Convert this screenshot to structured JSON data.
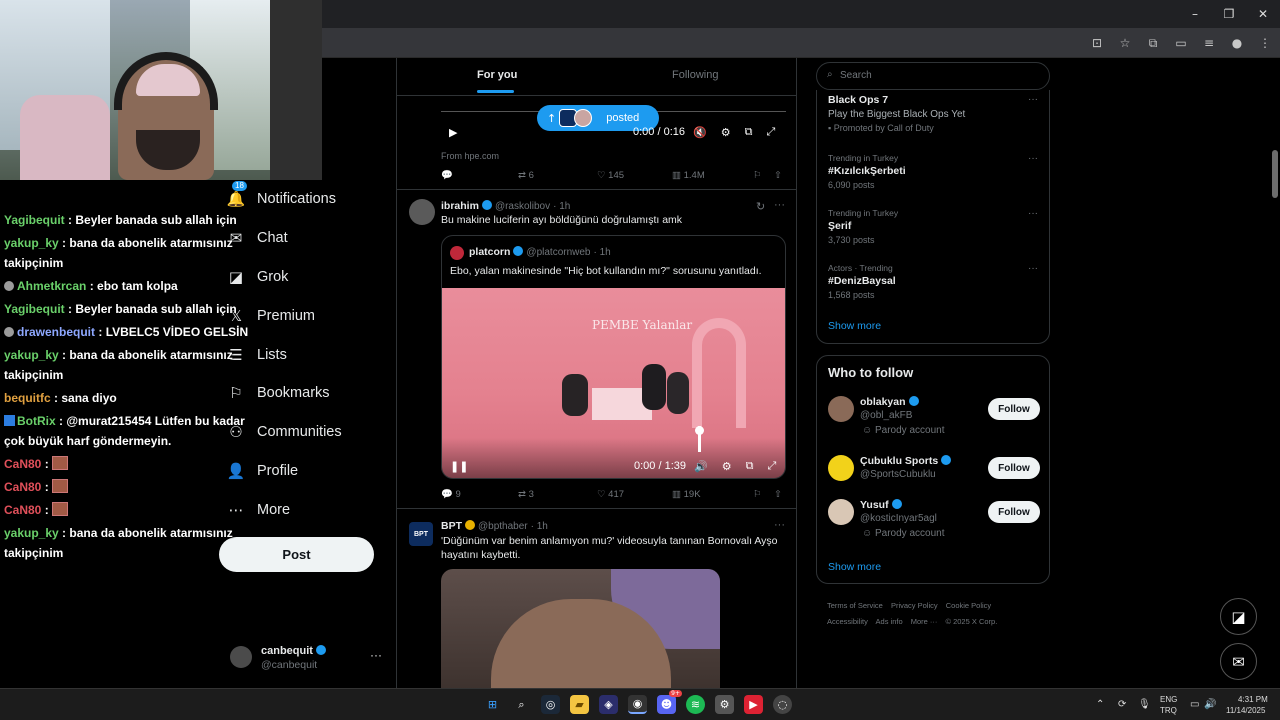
{
  "window": {
    "controls": [
      "–",
      "❐",
      "✕"
    ],
    "toolbar_icons": [
      "install-icon",
      "star-icon",
      "extensions-icon",
      "split-icon",
      "queue-icon",
      "profile-icon",
      "menu-icon"
    ]
  },
  "stream_chat": [
    {
      "user": "Yagibequit",
      "user_color": "#6ad06a",
      "text": "Beyler banada sub allah için"
    },
    {
      "user": "yakup_ky",
      "user_color": "#6ad06a",
      "text": "bana da abonelik atarmısınız takipçinim"
    },
    {
      "user": "Ahmetkrcan",
      "user_color": "#6ad06a",
      "badge": true,
      "text": "ebo tam kolpa"
    },
    {
      "user": "Yagibequit",
      "user_color": "#6ad06a",
      "text": "Beyler banada sub allah için"
    },
    {
      "user": "drawenbequit",
      "user_color": "#8ea8ff",
      "badge": true,
      "text": "LVBELC5 VİDEO GELSİN"
    },
    {
      "user": "yakup_ky",
      "user_color": "#6ad06a",
      "text": "bana da abonelik atarmısınız takipçinim"
    },
    {
      "user": "bequitfc",
      "user_color": "#e0a040",
      "text": "sana diyo"
    },
    {
      "user": "BotRix",
      "user_color": "#6ad06a",
      "bot": true,
      "text": "@murat215454 Lütfen bu kadar çok büyük harf göndermeyin."
    },
    {
      "user": "CaN80",
      "user_color": "#e0505a",
      "emote": true,
      "text": ""
    },
    {
      "user": "CaN80",
      "user_color": "#e0505a",
      "emote": true,
      "text": ""
    },
    {
      "user": "CaN80",
      "user_color": "#e0505a",
      "emote": true,
      "text": ""
    },
    {
      "user": "yakup_ky",
      "user_color": "#6ad06a",
      "text": "bana da abonelik atarmısınız takipçinim"
    }
  ],
  "nav": {
    "notifications_count": "18",
    "items": [
      {
        "label": "Notifications",
        "icon": "🔔"
      },
      {
        "label": "Chat",
        "icon": "✉"
      },
      {
        "label": "Grok",
        "icon": "◪"
      },
      {
        "label": "Premium",
        "icon": "𝕏"
      },
      {
        "label": "Lists",
        "icon": "☰"
      },
      {
        "label": "Bookmarks",
        "icon": "⚐"
      },
      {
        "label": "Communities",
        "icon": "⚇"
      },
      {
        "label": "Profile",
        "icon": "👤"
      },
      {
        "label": "More",
        "icon": "⋯"
      }
    ],
    "post_label": "Post",
    "account_name": "canbequit",
    "account_handle": "@canbequit",
    "account_more": "···"
  },
  "feed": {
    "tab_foryou": "For you",
    "tab_following": "Following",
    "posted_pill": "posted",
    "video1": {
      "time": "0:00 / 0:16",
      "source": "From hpe.com"
    },
    "post0_actions": {
      "reposts": "6",
      "likes": "145",
      "views": "1.4M"
    },
    "tweet1": {
      "name": "ibrahim",
      "handle": "@raskolibov",
      "time": "· 1h",
      "text": "Bu makine luciferin ayı böldüğünü doğrulamıştı amk",
      "quote": {
        "name": "platcorn",
        "handle": "@platcornweb",
        "time": "· 1h",
        "text": "Ebo, yalan makinesinde \"Hiç bot kullandın mı?\" sorusunu yanıtladı.",
        "sign": "PEMBE Yalanlar",
        "video_time": "0:00 / 1:39"
      },
      "actions": {
        "replies": "9",
        "reposts": "3",
        "likes": "417",
        "views": "19K"
      }
    },
    "tweet2": {
      "name": "BPT",
      "avatar_text": "BPT",
      "handle": "@bpthaber",
      "time": "· 1h",
      "text_line1": "'Düğünüm var benim anlamıyon mu?' videosuyla tanınan Bornovalı Ayşo",
      "text_line2": "hayatını kaybetti."
    }
  },
  "right": {
    "search_placeholder": "Search",
    "trends": [
      {
        "top": "",
        "title": "Black Ops 7",
        "sub": "Play the Biggest Black Ops Yet",
        "meta": "Promoted by Call of Duty"
      },
      {
        "top": "Trending in Turkey",
        "title": "#KızılcıkŞerbeti",
        "sub": "",
        "meta": "6,090 posts"
      },
      {
        "top": "Trending in Turkey",
        "title": "Şerif",
        "sub": "",
        "meta": "3,730 posts"
      },
      {
        "top": "Actors · Trending",
        "title": "#DenizBaysal",
        "sub": "",
        "meta": "1,568 posts"
      }
    ],
    "show_more": "Show more",
    "who_to_follow_title": "Who to follow",
    "follow_label": "Follow",
    "follows": [
      {
        "name": "oblakyan",
        "handle": "@obl_akFB",
        "parody": "Parody account",
        "avatar_color": "#8a6a58"
      },
      {
        "name": "Çubuklu Sports",
        "handle": "@SportsCubuklu",
        "parody": "",
        "avatar_color": "#f2d21a"
      },
      {
        "name": "Yusuf",
        "handle": "@kosticInyar5agl",
        "parody": "Parody account",
        "avatar_color": "#d9c7b5"
      }
    ],
    "footer_links": [
      "Terms of Service",
      "Privacy Policy",
      "Cookie Policy",
      "Accessibility",
      "Ads info",
      "More ···",
      "© 2025 X Corp."
    ]
  },
  "taskbar": {
    "lang_top": "ENG",
    "lang_bottom": "TRQ",
    "time": "4:31 PM",
    "date": "11/14/2025",
    "discord_badge": "9+"
  }
}
